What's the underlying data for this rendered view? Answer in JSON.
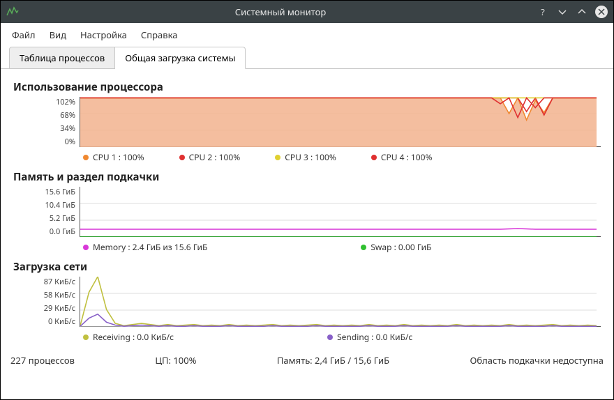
{
  "window": {
    "title": "Системный монитор"
  },
  "menu": {
    "file": "Файл",
    "view": "Вид",
    "settings": "Настройка",
    "help": "Справка"
  },
  "tabs": {
    "processes": "Таблица процессов",
    "system_load": "Общая загрузка системы"
  },
  "sections": {
    "cpu": {
      "title": "Использование процессора"
    },
    "mem": {
      "title": "Память и раздел подкачки"
    },
    "net": {
      "title": "Загрузка сети"
    }
  },
  "cpu_ticks": {
    "t0": "102%",
    "t1": "68%",
    "t2": "34%",
    "t3": "0%"
  },
  "mem_ticks": {
    "t0": "15.6 ГиБ",
    "t1": "10.4 ГиБ",
    "t2": "5.2 ГиБ",
    "t3": "0.0 ГиБ"
  },
  "net_ticks": {
    "t0": "87 КиБ/c",
    "t1": "58 КиБ/c",
    "t2": "29 КиБ/c",
    "t3": "0 КиБ/c"
  },
  "cpu_legend": {
    "cpu1": "CPU 1 : 100%",
    "cpu2": "CPU 2 : 100%",
    "cpu3": "CPU 3 : 100%",
    "cpu4": "CPU 4 : 100%"
  },
  "mem_legend": {
    "memory": "Memory : 2.4 ГиБ из 15.6 ГиБ",
    "swap": "Swap : 0.00 ГиБ"
  },
  "net_legend": {
    "receiving": "Receiving : 0.0 КиБ/с",
    "sending": "Sending : 0.0 КиБ/с"
  },
  "status": {
    "processes": "227 процессов",
    "cpu": "ЦП: 100%",
    "memory": "Память: 2,4 ГиБ / 15,6 ГиБ",
    "swap": "Область подкачки недоступна"
  },
  "colors": {
    "cpu1": "#f08830",
    "cpu2": "#e03030",
    "cpu3": "#e0d030",
    "cpu4": "#e03030",
    "cpu_fill": "#f2b38e",
    "memory": "#d838d8",
    "swap": "#30c030",
    "receiving": "#c0c040",
    "sending": "#8860c8",
    "grid": "#dddddd"
  },
  "chart_data": [
    {
      "type": "line",
      "title": "Использование процессора",
      "ylabel": "%",
      "ylim": [
        0,
        102
      ],
      "x": [
        0,
        1,
        2,
        3,
        4,
        5,
        6,
        7,
        8,
        9,
        10,
        11,
        12,
        13,
        14,
        15,
        16,
        17,
        18,
        19,
        20,
        21,
        22,
        23,
        24,
        25,
        26,
        27,
        28,
        29,
        30,
        31,
        32,
        33,
        34,
        35,
        36,
        37,
        38,
        39,
        40,
        41,
        42,
        43,
        44,
        45,
        46,
        47,
        48,
        49,
        50,
        51,
        52,
        53,
        54,
        55,
        56,
        57,
        58,
        59
      ],
      "series": [
        {
          "name": "CPU 1",
          "color": "#f08830",
          "values": [
            100,
            100,
            100,
            100,
            100,
            100,
            100,
            100,
            100,
            100,
            100,
            100,
            100,
            100,
            100,
            100,
            100,
            100,
            100,
            100,
            100,
            100,
            100,
            100,
            100,
            100,
            100,
            100,
            100,
            100,
            100,
            100,
            100,
            100,
            100,
            100,
            100,
            100,
            100,
            100,
            100,
            100,
            100,
            100,
            100,
            100,
            100,
            100,
            100,
            68,
            100,
            55,
            95,
            70,
            100,
            100,
            100,
            100,
            100,
            100
          ]
        },
        {
          "name": "CPU 2",
          "color": "#e03030",
          "values": [
            100,
            100,
            100,
            100,
            100,
            100,
            100,
            100,
            100,
            100,
            100,
            100,
            100,
            100,
            100,
            100,
            100,
            100,
            100,
            100,
            100,
            100,
            100,
            100,
            100,
            100,
            100,
            100,
            100,
            100,
            100,
            100,
            100,
            100,
            100,
            100,
            100,
            100,
            100,
            100,
            100,
            100,
            100,
            100,
            100,
            100,
            100,
            100,
            100,
            100,
            100,
            72,
            100,
            65,
            100,
            100,
            100,
            100,
            100,
            100
          ]
        },
        {
          "name": "CPU 3",
          "color": "#e0d030",
          "values": [
            100,
            100,
            100,
            100,
            100,
            100,
            100,
            100,
            100,
            100,
            100,
            100,
            100,
            100,
            100,
            100,
            100,
            100,
            100,
            100,
            100,
            100,
            100,
            100,
            100,
            100,
            100,
            100,
            100,
            100,
            100,
            100,
            100,
            100,
            100,
            100,
            100,
            100,
            100,
            100,
            100,
            100,
            100,
            100,
            100,
            100,
            100,
            100,
            100,
            100,
            100,
            100,
            100,
            100,
            100,
            100,
            100,
            100,
            100,
            100
          ]
        },
        {
          "name": "CPU 4",
          "color": "#e03030",
          "values": [
            100,
            100,
            100,
            100,
            100,
            100,
            100,
            100,
            100,
            100,
            100,
            100,
            100,
            100,
            100,
            100,
            100,
            100,
            100,
            100,
            100,
            100,
            100,
            100,
            100,
            100,
            100,
            100,
            100,
            100,
            100,
            100,
            100,
            100,
            100,
            100,
            100,
            100,
            100,
            100,
            100,
            100,
            100,
            100,
            100,
            100,
            100,
            100,
            88,
            100,
            60,
            100,
            80,
            100,
            100,
            100,
            100,
            100,
            100,
            100
          ]
        }
      ]
    },
    {
      "type": "line",
      "title": "Память и раздел подкачки",
      "ylabel": "ГиБ",
      "ylim": [
        0,
        15.6
      ],
      "x": [
        0,
        1,
        2,
        3,
        4,
        5,
        6,
        7,
        8,
        9,
        10,
        11,
        12,
        13,
        14,
        15,
        16,
        17,
        18,
        19,
        20,
        21,
        22,
        23,
        24,
        25,
        26,
        27,
        28,
        29,
        30,
        31,
        32,
        33,
        34,
        35,
        36,
        37,
        38,
        39,
        40,
        41,
        42,
        43,
        44,
        45,
        46,
        47,
        48,
        49,
        50,
        51,
        52,
        53,
        54,
        55,
        56,
        57,
        58,
        59
      ],
      "series": [
        {
          "name": "Memory",
          "color": "#d838d8",
          "values": [
            2.4,
            2.4,
            2.4,
            2.4,
            2.4,
            2.4,
            2.4,
            2.4,
            2.4,
            2.4,
            2.4,
            2.4,
            2.4,
            2.4,
            2.4,
            2.4,
            2.4,
            2.4,
            2.4,
            2.4,
            2.4,
            2.4,
            2.4,
            2.4,
            2.4,
            2.4,
            2.4,
            2.4,
            2.4,
            2.4,
            2.4,
            2.4,
            2.4,
            2.4,
            2.4,
            2.4,
            2.4,
            2.4,
            2.4,
            2.4,
            2.4,
            2.4,
            2.4,
            2.4,
            2.4,
            2.4,
            2.4,
            2.4,
            2.4,
            2.5,
            2.6,
            2.5,
            2.4,
            2.4,
            2.4,
            2.4,
            2.4,
            2.4,
            2.4,
            2.4
          ]
        },
        {
          "name": "Swap",
          "color": "#30c030",
          "values": [
            0,
            0,
            0,
            0,
            0,
            0,
            0,
            0,
            0,
            0,
            0,
            0,
            0,
            0,
            0,
            0,
            0,
            0,
            0,
            0,
            0,
            0,
            0,
            0,
            0,
            0,
            0,
            0,
            0,
            0,
            0,
            0,
            0,
            0,
            0,
            0,
            0,
            0,
            0,
            0,
            0,
            0,
            0,
            0,
            0,
            0,
            0,
            0,
            0,
            0,
            0,
            0,
            0,
            0,
            0,
            0,
            0,
            0,
            0,
            0
          ]
        }
      ]
    },
    {
      "type": "line",
      "title": "Загрузка сети",
      "ylabel": "КиБ/c",
      "ylim": [
        0,
        87
      ],
      "x": [
        0,
        1,
        2,
        3,
        4,
        5,
        6,
        7,
        8,
        9,
        10,
        11,
        12,
        13,
        14,
        15,
        16,
        17,
        18,
        19,
        20,
        21,
        22,
        23,
        24,
        25,
        26,
        27,
        28,
        29,
        30,
        31,
        32,
        33,
        34,
        35,
        36,
        37,
        38,
        39,
        40,
        41,
        42,
        43,
        44,
        45,
        46,
        47,
        48,
        49,
        50,
        51,
        52,
        53,
        54,
        55,
        56,
        57,
        58,
        59
      ],
      "series": [
        {
          "name": "Receiving",
          "color": "#c0c040",
          "values": [
            2,
            60,
            87,
            30,
            6,
            2,
            4,
            6,
            4,
            2,
            4,
            2,
            3,
            4,
            2,
            3,
            2,
            4,
            2,
            3,
            2,
            3,
            4,
            2,
            3,
            2,
            3,
            4,
            2,
            3,
            2,
            3,
            2,
            4,
            2,
            3,
            2,
            4,
            2,
            3,
            2,
            3,
            2,
            4,
            2,
            3,
            2,
            3,
            2,
            4,
            2,
            3,
            2,
            3,
            4,
            2,
            3,
            2,
            3,
            2
          ]
        },
        {
          "name": "Sending",
          "color": "#8860c8",
          "values": [
            1,
            15,
            22,
            8,
            3,
            1,
            2,
            3,
            2,
            1,
            2,
            1,
            1,
            2,
            1,
            1,
            1,
            2,
            1,
            1,
            1,
            1,
            2,
            1,
            1,
            1,
            1,
            2,
            1,
            1,
            1,
            1,
            1,
            2,
            1,
            1,
            1,
            2,
            1,
            1,
            1,
            1,
            1,
            2,
            1,
            1,
            1,
            1,
            1,
            2,
            1,
            1,
            1,
            1,
            2,
            1,
            1,
            1,
            1,
            1
          ]
        }
      ]
    }
  ]
}
